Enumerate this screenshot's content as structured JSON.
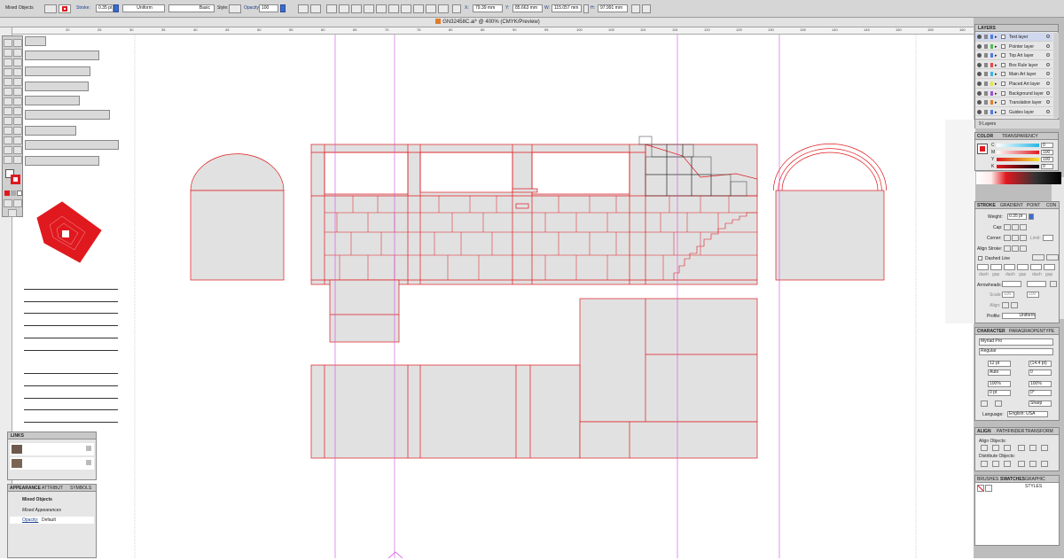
{
  "control_bar": {
    "selection": "Mixed Objects",
    "stroke_label": "Stroke:",
    "stroke_weight": "0.35 pt",
    "profile": "Uniform",
    "brush": "Basic",
    "style_label": "Style:",
    "opacity_label": "Opacity:",
    "opacity": "100",
    "x_label": "X:",
    "x": "79.39 mm",
    "y_label": "Y:",
    "y": "85.663 mm",
    "w_label": "W:",
    "w": "115.057 mm",
    "h_label": "H:",
    "h": "97.991 mm"
  },
  "document": {
    "title": "GN32458C.ai* @ 400% (CMYK/Preview)"
  },
  "ruler": {
    "ticks": [
      "20",
      "25",
      "30",
      "35",
      "40",
      "45",
      "50",
      "55",
      "60",
      "65",
      "70",
      "75",
      "80",
      "85",
      "90",
      "95",
      "100",
      "105",
      "110",
      "115",
      "120",
      "125",
      "130",
      "135",
      "140",
      "145",
      "150",
      "155",
      "160"
    ]
  },
  "layers_panel": {
    "title": "LAYERS",
    "layers": [
      {
        "name": "Text layer",
        "color": "#4f7ae2"
      },
      {
        "name": "Pointer layer",
        "color": "#4fbf4f"
      },
      {
        "name": "Top Art layer",
        "color": "#4f7ae2"
      },
      {
        "name": "Box Rule layer",
        "color": "#e44"
      },
      {
        "name": "Main Art layer",
        "color": "#3fb3e6"
      },
      {
        "name": "Placed Art layer",
        "color": "#e4e44a"
      },
      {
        "name": "Background layer",
        "color": "#9d4fd4"
      },
      {
        "name": "Translation layer",
        "color": "#e07d2a"
      },
      {
        "name": "Guides layer",
        "color": "#4f7ae2"
      }
    ],
    "count": "9 Layers"
  },
  "color_panel": {
    "tabs": [
      "COLOR",
      "TRANSPARENCY"
    ],
    "channels": [
      {
        "label": "C",
        "value": "0"
      },
      {
        "label": "M",
        "value": "100"
      },
      {
        "label": "Y",
        "value": "100"
      },
      {
        "label": "K",
        "value": "0"
      }
    ]
  },
  "stroke_panel": {
    "tabs": [
      "STROKE",
      "GRADIENT",
      "POINT",
      "CON"
    ],
    "weight_label": "Weight:",
    "weight": "0.35 pt",
    "cap_label": "Cap:",
    "corner_label": "Corner:",
    "limit_label": "Limit:",
    "align_label": "Align Stroke:",
    "dashed_label": "Dashed Line",
    "dash_labels": [
      "dash",
      "gap",
      "dash",
      "gap",
      "dash",
      "gap"
    ],
    "arrowheads_label": "Arrowheads:",
    "scale_label": "Scale:",
    "scale1": "100",
    "scale2": "100",
    "align2_label": "Align:",
    "profile_label": "Profile:",
    "profile": "Uniform"
  },
  "character_panel": {
    "tabs": [
      "CHARACTER",
      "PARAGRA",
      "OPENTYPE"
    ],
    "font": "Myriad Pro",
    "style": "Regular",
    "size": "12 pt",
    "leading": "(14.4 pt)",
    "kerning": "Auto",
    "tracking": "0",
    "vscale": "100%",
    "hscale": "100%",
    "baseline": "0 pt",
    "rotation": "0°",
    "aa": "Sharp",
    "language_label": "Language:",
    "language": "English: USA"
  },
  "align_panel": {
    "tabs": [
      "ALIGN",
      "PATHFINDER",
      "TRANSFORM"
    ],
    "align_objects": "Align Objects:",
    "distribute_objects": "Distribute Objects:"
  },
  "swatches_tabs": [
    "BRUSHES",
    "SWATCHES",
    "GRAPHIC STYLES"
  ],
  "links_panel": {
    "title": "LINKS"
  },
  "appearance_panel": {
    "tabs": [
      "APPEARANCE",
      "ATTRIBUT",
      "SYMBOLS"
    ],
    "title": "Mixed Objects",
    "sub": "Mixed Appearances",
    "opacity_label": "Opacity:",
    "opacity": "Default"
  },
  "colors": {
    "stroke_red": "#e0191f",
    "fill_gray": "#e1e1e1",
    "guide_magenta": "#d14be2"
  }
}
